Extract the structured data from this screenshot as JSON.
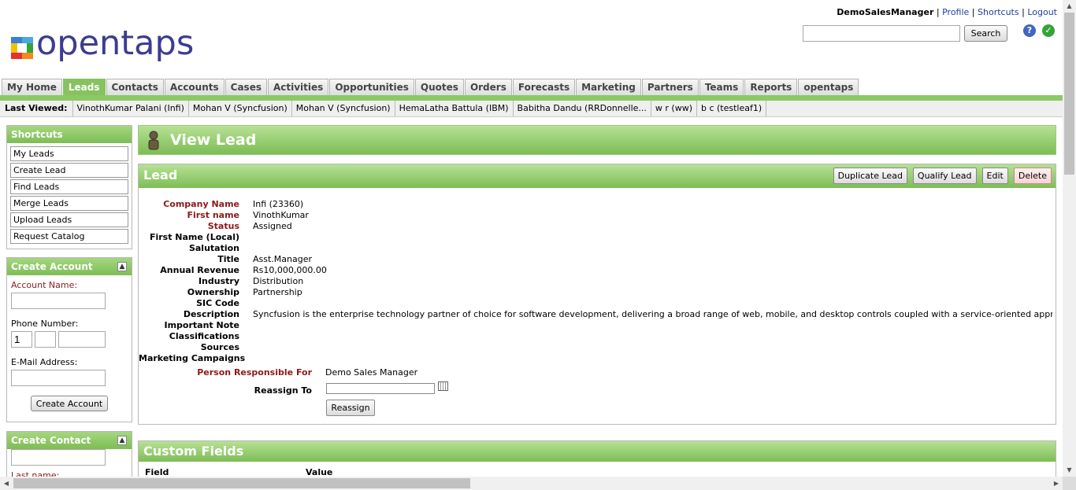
{
  "user": {
    "name": "DemoSalesManager",
    "links": [
      "Profile",
      "Shortcuts",
      "Logout"
    ],
    "sep": "|"
  },
  "search": {
    "button": "Search",
    "value": ""
  },
  "logo": {
    "text": "opentaps"
  },
  "tabs": [
    "My Home",
    "Leads",
    "Contacts",
    "Accounts",
    "Cases",
    "Activities",
    "Opportunities",
    "Quotes",
    "Orders",
    "Forecasts",
    "Marketing",
    "Partners",
    "Teams",
    "Reports",
    "opentaps"
  ],
  "active_tab": "Leads",
  "last_viewed": {
    "label": "Last Viewed:",
    "items": [
      "VinothKumar Palani (Infi)",
      "Mohan V (Syncfusion)",
      "Mohan V (Syncfusion)",
      "HemaLatha Battula (IBM)",
      "Babitha Dandu (RRDonnelle...",
      "w r (ww)",
      "b c (testleaf1)"
    ]
  },
  "shortcuts": {
    "title": "Shortcuts",
    "items": [
      "My Leads",
      "Create Lead",
      "Find Leads",
      "Merge Leads",
      "Upload Leads",
      "Request Catalog"
    ]
  },
  "create_account": {
    "title": "Create Account",
    "account_name_label": "Account Name:",
    "phone_label": "Phone Number:",
    "phone_country": "1",
    "email_label": "E-Mail Address:",
    "button": "Create Account"
  },
  "create_contact": {
    "title": "Create Contact",
    "last_name_label": "Last name:"
  },
  "page": {
    "title": "View Lead"
  },
  "lead": {
    "title": "Lead",
    "buttons": [
      "Duplicate Lead",
      "Qualify Lead",
      "Edit",
      "Delete"
    ],
    "fields": [
      {
        "label": "Company Name",
        "value": "Infi (23360)",
        "required": true
      },
      {
        "label": "First name",
        "value": "VinothKumar",
        "required": true
      },
      {
        "label": "Status",
        "value": "Assigned",
        "required": true
      },
      {
        "label": "First Name (Local)",
        "value": "",
        "required": false
      },
      {
        "label": "Salutation",
        "value": "",
        "required": false
      },
      {
        "label": "Title",
        "value": "Asst.Manager",
        "required": false
      },
      {
        "label": "Annual Revenue",
        "value": "Rs10,000,000.00",
        "required": false
      },
      {
        "label": "Industry",
        "value": "Distribution",
        "required": false
      },
      {
        "label": "Ownership",
        "value": "Partnership",
        "required": false
      },
      {
        "label": "SIC Code",
        "value": "",
        "required": false
      },
      {
        "label": "Description",
        "value": "Syncfusion is the enterprise technology partner of choice for software development, delivering a broad range of web, mobile, and desktop controls coupled with a service-oriented approach throughout the",
        "required": false
      },
      {
        "label": "Important Note",
        "value": "",
        "required": false
      },
      {
        "label": "Classifications",
        "value": "",
        "required": false
      },
      {
        "label": "Sources",
        "value": "",
        "required": false
      },
      {
        "label": "Marketing Campaigns",
        "value": "",
        "required": false
      }
    ],
    "person_responsible_label": "Person Responsible For",
    "person_responsible_value": "Demo Sales Manager",
    "reassign_label": "Reassign To",
    "reassign_button": "Reassign"
  },
  "custom_fields": {
    "title": "Custom Fields",
    "col_field": "Field",
    "col_value": "Value"
  },
  "colors": {
    "green": "#8cc965",
    "required_label": "#8b1a1a",
    "link": "#1f3e9b"
  }
}
